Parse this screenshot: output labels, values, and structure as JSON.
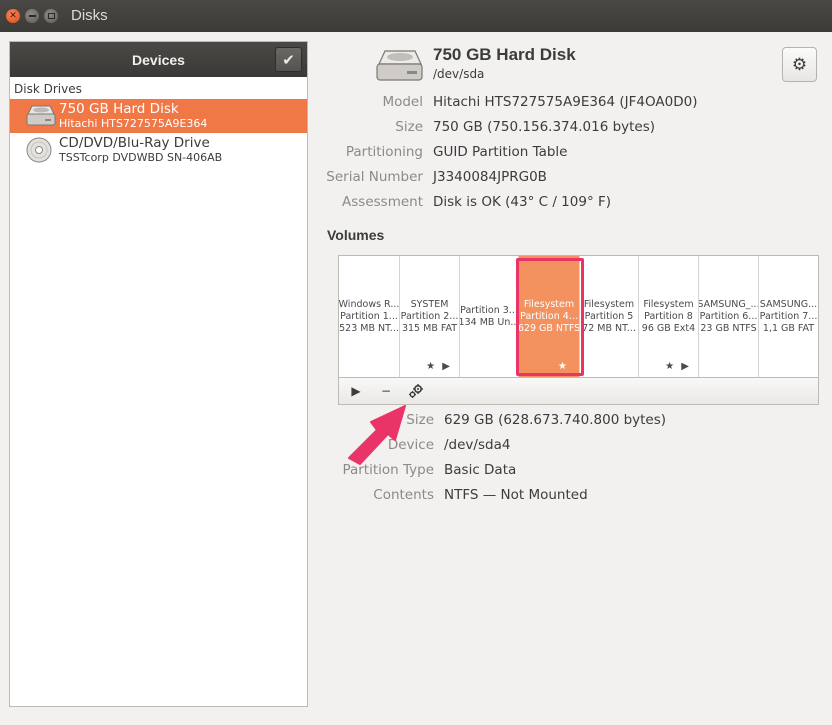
{
  "window": {
    "title": "Disks"
  },
  "sidebar": {
    "title": "Devices",
    "section": "Disk Drives",
    "drives": [
      {
        "name": "750 GB Hard Disk",
        "subtitle": "Hitachi HTS727575A9E364",
        "selected": true,
        "icon": "hard-disk-icon"
      },
      {
        "name": "CD/DVD/Blu-Ray Drive",
        "subtitle": "TSSTcorp DVDWBD SN-406AB",
        "selected": false,
        "icon": "optical-disc-icon"
      }
    ]
  },
  "disk": {
    "title": "750 GB Hard Disk",
    "device": "/dev/sda",
    "properties": [
      {
        "label": "Model",
        "value": "Hitachi HTS727575A9E364 (JF4OA0D0)"
      },
      {
        "label": "Size",
        "value": "750 GB (750.156.374.016 bytes)"
      },
      {
        "label": "Partitioning",
        "value": "GUID Partition Table"
      },
      {
        "label": "Serial Number",
        "value": "J3340084JPRG0B"
      },
      {
        "label": "Assessment",
        "value": "Disk is OK (43° C / 109° F)"
      }
    ]
  },
  "volumes": {
    "heading": "Volumes",
    "partitions": [
      {
        "line1": "Windows R...",
        "line2": "Partition 1...",
        "line3": "523 MB NT...",
        "flags": "",
        "selected": false
      },
      {
        "line1": "SYSTEM",
        "line2": "Partition 2...",
        "line3": "315 MB FAT",
        "flags": "★ ▶",
        "selected": false
      },
      {
        "line1": "Partition 3...",
        "line2": "134 MB Un...",
        "line3": "",
        "flags": "",
        "selected": false
      },
      {
        "line1": "Filesystem",
        "line2": "Partition 4...",
        "line3": "629 GB NTFS",
        "flags": "★",
        "selected": true
      },
      {
        "line1": "Filesystem",
        "line2": "Partition 5",
        "line3": "72 MB NT...",
        "flags": "",
        "selected": false
      },
      {
        "line1": "Filesystem",
        "line2": "Partition 8",
        "line3": "96 GB Ext4",
        "flags": "★ ▶",
        "selected": false
      },
      {
        "line1": "SAMSUNG_...",
        "line2": "Partition 6...",
        "line3": "23 GB NTFS",
        "flags": "",
        "selected": false
      },
      {
        "line1": "SAMSUNG...",
        "line2": "Partition 7...",
        "line3": "1,1 GB FAT",
        "flags": "",
        "selected": false
      }
    ],
    "toolbar": {
      "mount_icon": "▶",
      "delete_icon": "−",
      "settings_icon": "gears-icon"
    }
  },
  "partition": {
    "properties": [
      {
        "label": "Size",
        "value": "629 GB (628.673.740.800 bytes)"
      },
      {
        "label": "Device",
        "value": "/dev/sda4"
      },
      {
        "label": "Partition Type",
        "value": "Basic Data"
      },
      {
        "label": "Contents",
        "value": "NTFS — Not Mounted"
      }
    ]
  },
  "annotation": {
    "highlight_color": "#ea3468"
  },
  "colors": {
    "accent": "#f07746",
    "selected_partition": "#f3925f"
  }
}
